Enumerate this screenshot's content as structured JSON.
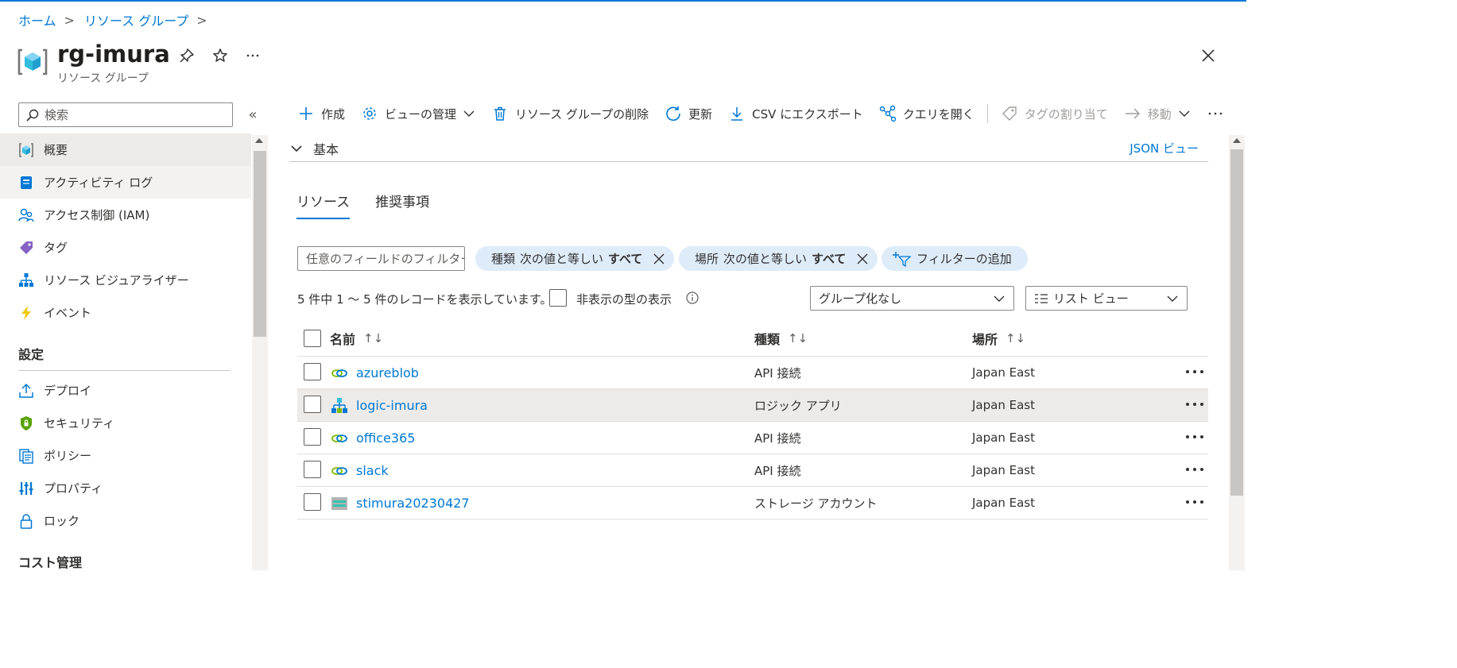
{
  "breadcrumb": [
    "ホーム",
    "リソース グループ"
  ],
  "header": {
    "title": "rg-imura",
    "subtitle": "リソース グループ"
  },
  "search": {
    "placeholder": "検索"
  },
  "sidebar": {
    "items": [
      {
        "label": "概要",
        "icon": "resource-group-icon"
      },
      {
        "label": "アクティビティ ログ",
        "icon": "activity-log-icon"
      },
      {
        "label": "アクセス制御 (IAM)",
        "icon": "iam-icon"
      },
      {
        "label": "タグ",
        "icon": "tag-icon"
      },
      {
        "label": "リソース ビジュアライザー",
        "icon": "visualizer-icon"
      },
      {
        "label": "イベント",
        "icon": "lightning-icon"
      }
    ],
    "section_settings": "設定",
    "settings_items": [
      {
        "label": "デプロイ",
        "icon": "deploy-icon"
      },
      {
        "label": "セキュリティ",
        "icon": "shield-icon"
      },
      {
        "label": "ポリシー",
        "icon": "policy-icon"
      },
      {
        "label": "プロパティ",
        "icon": "properties-icon"
      },
      {
        "label": "ロック",
        "icon": "lock-icon"
      }
    ],
    "section_cost": "コスト管理"
  },
  "toolbar": {
    "create": "作成",
    "manage_view": "ビューの管理",
    "delete_group": "リソース グループの削除",
    "refresh": "更新",
    "export_csv": "CSV にエクスポート",
    "open_query": "クエリを開く",
    "assign_tags": "タグの割り当て",
    "move": "移動"
  },
  "essentials": {
    "label": "基本",
    "json_view": "JSON ビュー"
  },
  "tabs": [
    "リソース",
    "推奨事項"
  ],
  "filters": {
    "field_placeholder": "任意のフィールドのフィルター...",
    "type_pill": {
      "name": "種類",
      "op": "次の値と等しい",
      "value": "すべて"
    },
    "location_pill": {
      "name": "場所",
      "op": "次の値と等しい",
      "value": "すべて"
    },
    "add_filter": "フィルターの追加"
  },
  "records_text": "5 件中 1 〜 5 件のレコードを表示しています。",
  "show_hidden_types": "非表示の型の表示",
  "grouping": "グループ化なし",
  "view_mode": "リスト ビュー",
  "table": {
    "columns": [
      "名前",
      "種類",
      "場所"
    ],
    "rows": [
      {
        "name": "azureblob",
        "type": "API 接続",
        "location": "Japan East",
        "icon": "api-connection-icon"
      },
      {
        "name": "logic-imura",
        "type": "ロジック アプリ",
        "location": "Japan East",
        "icon": "logic-app-icon"
      },
      {
        "name": "office365",
        "type": "API 接続",
        "location": "Japan East",
        "icon": "api-connection-icon"
      },
      {
        "name": "slack",
        "type": "API 接続",
        "location": "Japan East",
        "icon": "api-connection-icon"
      },
      {
        "name": "stimura20230427",
        "type": "ストレージ アカウント",
        "location": "Japan East",
        "icon": "storage-account-icon"
      }
    ]
  },
  "colors": {
    "accent": "#0078d4",
    "pill": "#deecf9",
    "selected": "#edebe9"
  }
}
